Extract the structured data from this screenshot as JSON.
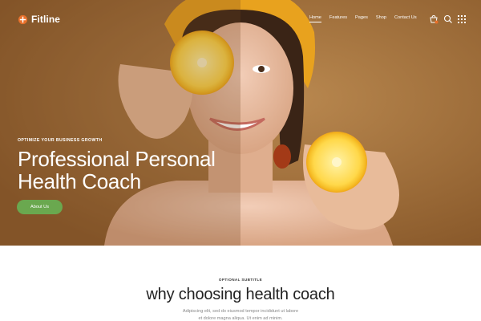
{
  "brand": {
    "name": "Fitline",
    "accent": "#e8702a",
    "button_color": "#6aa84f"
  },
  "nav": {
    "items": [
      {
        "label": "Home",
        "active": true
      },
      {
        "label": "Features",
        "active": false
      },
      {
        "label": "Pages",
        "active": false
      },
      {
        "label": "Shop",
        "active": false
      },
      {
        "label": "Contact Us",
        "active": false
      }
    ],
    "icons": [
      "cart-icon",
      "search-icon",
      "grid-menu-icon"
    ]
  },
  "hero": {
    "eyebrow": "OPTIMIZE YOUR BUSINESS GROWTH",
    "title_line1": "Professional Personal",
    "title_line2": "Health Coach",
    "button_label": "About Us"
  },
  "section": {
    "subtitle": "OPTIONAL SUBTITLE",
    "title": "why choosing health coach",
    "text_line1": "Adipiscing elit, sed do eiusmod tempor incididunt ut labore",
    "text_line2": "et dolore magna aliqua. Ut enim ad minim."
  }
}
